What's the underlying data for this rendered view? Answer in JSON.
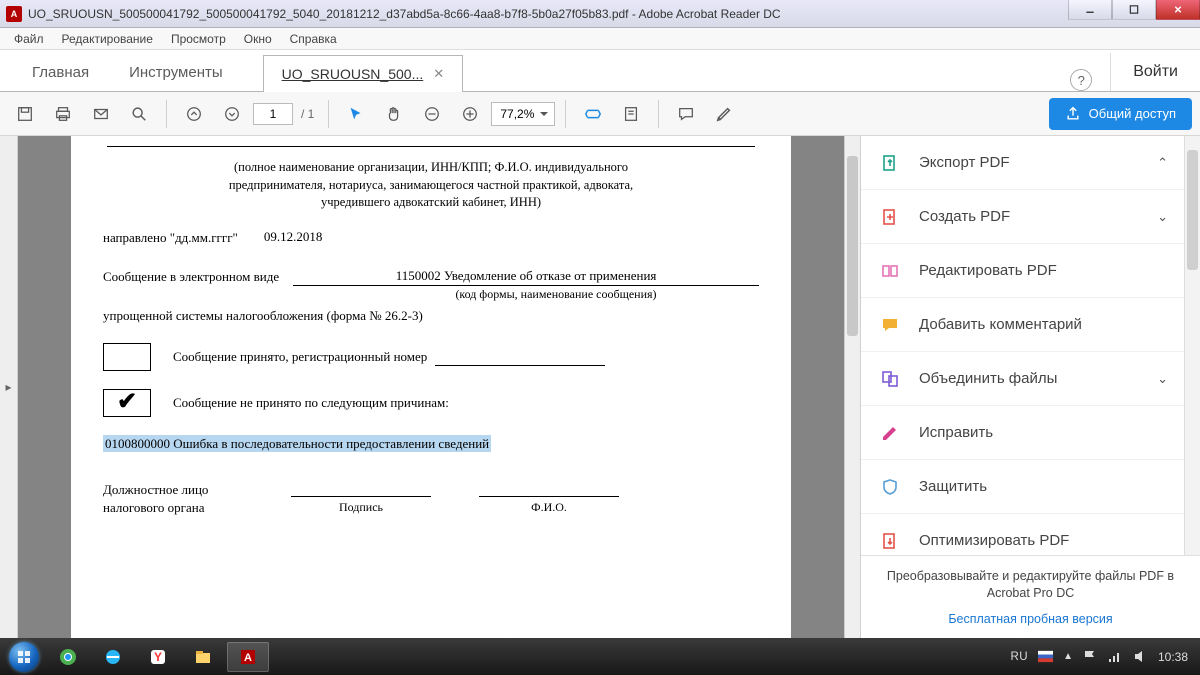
{
  "window": {
    "title": "UO_SRUOUSN_500500041792_500500041792_5040_20181212_d37abd5a-8c66-4aa8-b7f8-5b0a27f05b83.pdf - Adobe Acrobat Reader DC"
  },
  "menu": [
    "Файл",
    "Редактирование",
    "Просмотр",
    "Окно",
    "Справка"
  ],
  "tabs": {
    "home": "Главная",
    "tools": "Инструменты",
    "doc": "UO_SRUOUSN_500...",
    "login": "Войти"
  },
  "toolbar": {
    "page_current": "1",
    "page_total": "/ 1",
    "zoom": "77,2%",
    "share": "Общий доступ"
  },
  "document": {
    "header1": "(полное наименование организации, ИНН/КПП; Ф.И.О. индивидуального",
    "header2": "предпринимателя, нотариуса, занимающегося частной практикой, адвоката,",
    "header3": "учредившего адвокатский кабинет, ИНН)",
    "sent_label": "направлено \"дд.мм.гггг\"",
    "sent_date": "09.12.2018",
    "msg_label": "Сообщение в электронном виде",
    "msg_code": "1150002 Уведомление об отказе от применения",
    "msg_sub": "(код формы, наименование сообщения)",
    "simplified": "упрощенной системы налогообложения (форма № 26.2-3)",
    "accepted": "Сообщение принято, регистрационный номер",
    "rejected": "Сообщение не принято по следующим причинам:",
    "error": "0100800000 Ошибка в последовательности предоставлении сведений",
    "official1": "Должностное лицо",
    "official2": "налогового органа",
    "sign": "Подпись",
    "fio": "Ф.И.О."
  },
  "rightPanel": {
    "items": [
      {
        "label": "Экспорт PDF",
        "icon": "export",
        "color": "#1da48a",
        "chev": "up"
      },
      {
        "label": "Создать PDF",
        "icon": "create",
        "color": "#e5534b",
        "chev": "down"
      },
      {
        "label": "Редактировать PDF",
        "icon": "edit",
        "color": "#e673b5",
        "chev": ""
      },
      {
        "label": "Добавить комментарий",
        "icon": "comment",
        "color": "#f2b134",
        "chev": ""
      },
      {
        "label": "Объединить файлы",
        "icon": "combine",
        "color": "#7e5bd6",
        "chev": "down"
      },
      {
        "label": "Исправить",
        "icon": "redact",
        "color": "#d6418f",
        "chev": ""
      },
      {
        "label": "Защитить",
        "icon": "protect",
        "color": "#5a9fd6",
        "chev": ""
      },
      {
        "label": "Оптимизировать PDF",
        "icon": "optimize",
        "color": "#e5534b",
        "chev": ""
      }
    ],
    "promo": "Преобразовывайте и редактируйте файлы PDF в Acrobat Pro DC",
    "trial": "Бесплатная пробная версия"
  },
  "taskbar": {
    "lang": "RU",
    "time": "10:38"
  }
}
